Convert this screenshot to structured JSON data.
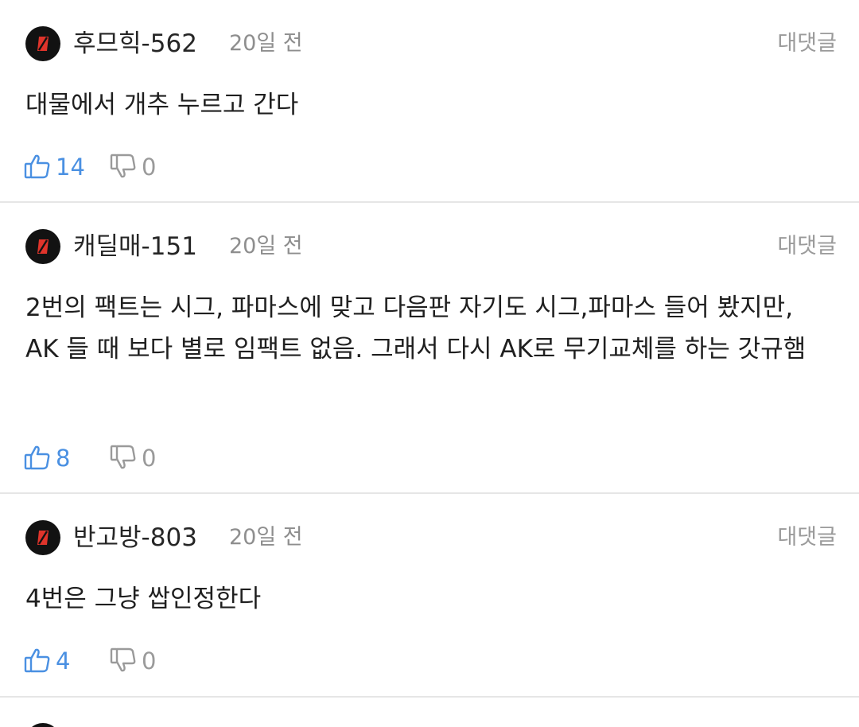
{
  "colors": {
    "like": "#4a90e2",
    "dislike": "#9a9a9a",
    "avatar_bg": "#121212",
    "avatar_mark": "#e0342b"
  },
  "icons": {
    "avatar": "avatar-logo-icon",
    "like": "thumbs-up-icon",
    "dislike": "thumbs-down-icon"
  },
  "comments": [
    {
      "nickname": "후므힉-562",
      "time": "20일 전",
      "reply_label": "대댓글",
      "body": "대물에서 개추 누르고 간다",
      "likes": "14",
      "dislikes": "0"
    },
    {
      "nickname": "캐딜매-151",
      "time": "20일 전",
      "reply_label": "대댓글",
      "body": "2번의 팩트는 시그, 파마스에 맞고 다음판 자기도 시그,파마스 들어 봤지만, AK 들 때 보다 별로 임팩트 없음. 그래서 다시 AK로 무기교체를 하는 갓규햄",
      "likes": "8",
      "dislikes": "0"
    },
    {
      "nickname": "반고방-803",
      "time": "20일 전",
      "reply_label": "대댓글",
      "body": "4번은 그냥 쌉인정한다",
      "likes": "4",
      "dislikes": "0"
    }
  ]
}
